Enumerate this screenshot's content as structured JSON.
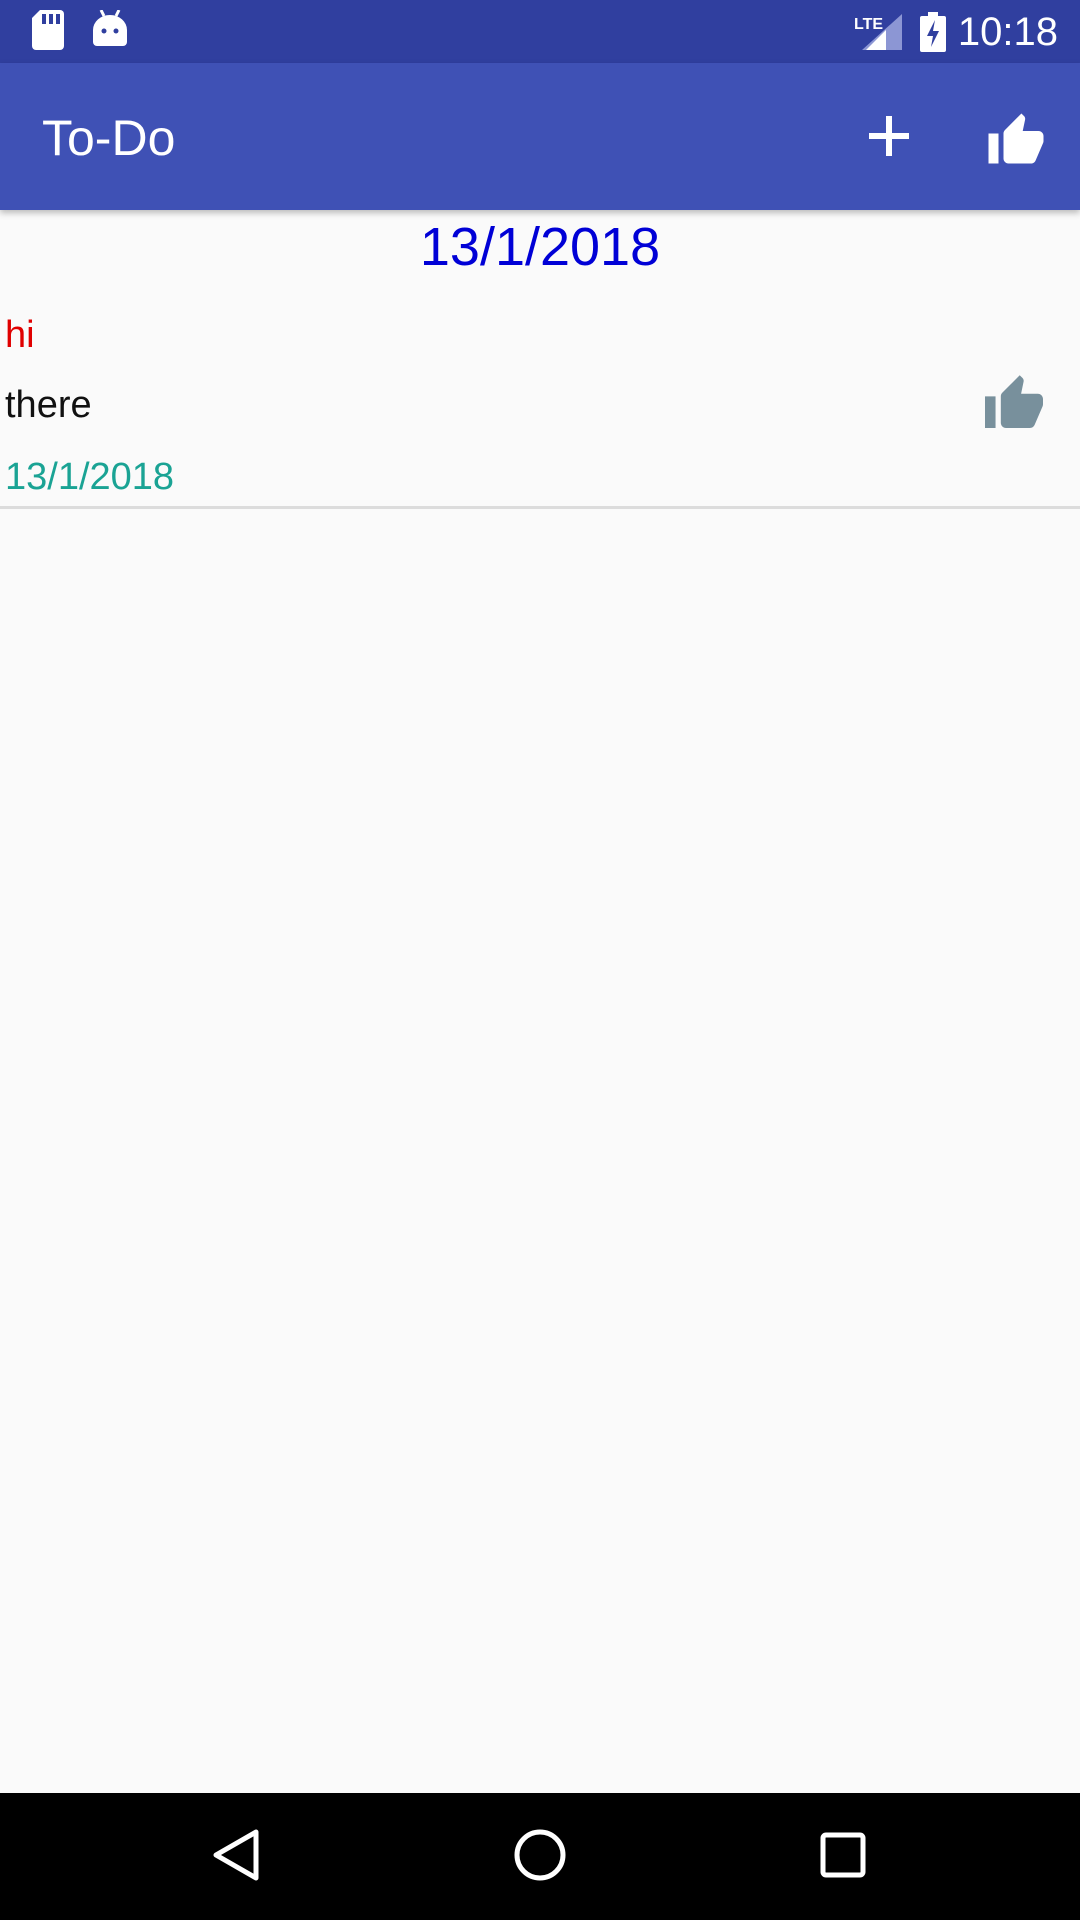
{
  "status_bar": {
    "time": "10:18",
    "network": "LTE",
    "icons": [
      "sd-card-icon",
      "android-icon",
      "lte-icon",
      "signal-icon",
      "battery-charging-icon"
    ]
  },
  "app_bar": {
    "title": "To-Do",
    "actions": [
      {
        "name": "add",
        "icon": "plus-icon"
      },
      {
        "name": "like",
        "icon": "thumbs-up-icon"
      }
    ]
  },
  "list": {
    "header_date": "13/1/2018",
    "items": [
      {
        "title": "hi",
        "description": "there",
        "date": "13/1/2018",
        "icon": "thumbs-up-icon"
      }
    ]
  },
  "nav_bar": {
    "icons": [
      "back-icon",
      "home-icon",
      "recents-icon"
    ]
  },
  "colors": {
    "status_bar": "#303f9f",
    "app_bar": "#3f51b5",
    "header_date": "#0000d6",
    "item_title": "#e00000",
    "item_date": "#1aa394",
    "like_icon": "#78909c"
  }
}
